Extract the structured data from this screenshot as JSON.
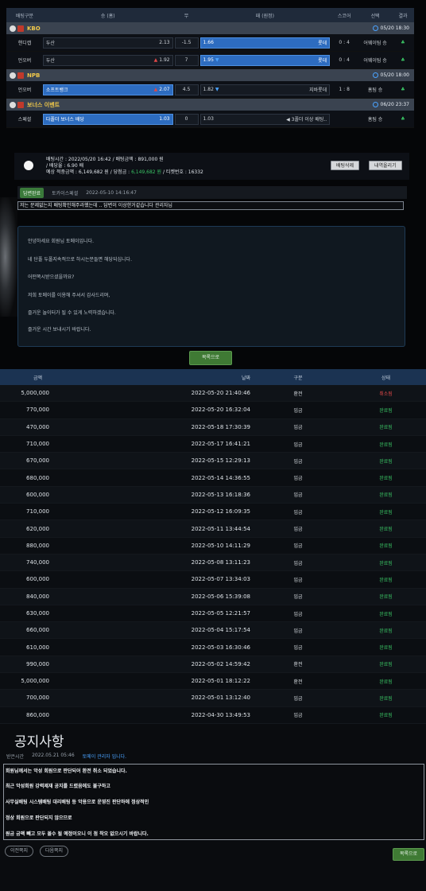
{
  "betslip": {
    "headers": [
      "배팅구분",
      "승 (홈)",
      "무",
      "패 (원정)",
      "스코어",
      "선택",
      "결과"
    ],
    "leagues": [
      {
        "name": "KBO",
        "date": "05/20 18:30",
        "rows": [
          {
            "type": "핸디캡",
            "home": "두산",
            "home_odds": "2.13",
            "home_arrow": "",
            "mid": "-1.5",
            "away": "롯데",
            "away_odds": "1.66",
            "away_arrow": "",
            "selected": "away",
            "score": "0 : 4",
            "pick": "어웨이팀 승",
            "result": "♣"
          },
          {
            "type": "언오버",
            "home": "두산",
            "home_odds": "1.92",
            "home_arrow": "▲",
            "mid": "7",
            "away": "롯데",
            "away_odds": "1.95",
            "away_arrow": "▼",
            "selected": "away",
            "score": "0 : 4",
            "pick": "어웨이팀 승",
            "result": "♣"
          }
        ]
      },
      {
        "name": "NPB",
        "date": "05/20 18:00",
        "rows": [
          {
            "type": "언오버",
            "home": "소프트뱅크",
            "home_odds": "2.07",
            "home_arrow": "▲",
            "mid": "4.5",
            "away": "지바롯데",
            "away_odds": "1.82",
            "away_arrow": "▼",
            "selected": "home",
            "score": "1 : 8",
            "pick": "홈팀 승",
            "result": "♣"
          }
        ]
      },
      {
        "name": "보너스 이벤트",
        "date": "06/20 23:37",
        "rows": [
          {
            "type": "스페셜",
            "home": "다폴더 보너스 배당",
            "home_odds": "1.03",
            "home_arrow": "",
            "mid": "0",
            "away": "◀ 3폴더 이상 배팅..",
            "away_odds": "1.03",
            "away_arrow": "",
            "selected": "home",
            "score": "",
            "pick": "홈팀 승",
            "result": "♣"
          }
        ]
      }
    ],
    "summary": {
      "line1": "배팅시간 : 2022/05/20 16:42  /  배팅금액 : 891,000 원",
      "line2": "/ 배당율 : 6.90 배",
      "line3_prefix": "예상 적중금액 : 6,149,682 원  /  당첨금 : ",
      "line3_win": "6,149,682 원",
      "line3_suffix": "  /  티켓번호 : 16332",
      "delete_label": "배팅삭제",
      "upload_label": "내역올리기"
    }
  },
  "inquiry": {
    "badge": "답변완료",
    "category": "토카이스페셜",
    "datetime": "2022-05-10 14:16:47",
    "title": "저는 문제없는지 배팅확인해주라했는데 .. 답변이 이상한거같습니다 관리자님",
    "lines": [
      "안녕하세요 회원님 토메이입니다.",
      "네 단폴 두폴지속적으로 하시는분들면 해당되십니다.",
      "어떤쪽시받으셨을까요?",
      "저희 토메이를 이용해 주셔서 감사드리며,",
      "즐거운 놀이터가 될 수 있게 노력하겠습니다.",
      "즐거운 시간 보내시기 바랍니다."
    ],
    "list_button": "목록으로"
  },
  "transactions": {
    "headers": [
      "금액",
      "날짜",
      "구분",
      "상태"
    ],
    "rows": [
      {
        "amount": "5,000,000",
        "date": "2022-05-20 21:40:46",
        "type": "환전",
        "status": "취소됨",
        "status_kind": "cancel"
      },
      {
        "amount": "770,000",
        "date": "2022-05-20 16:32:04",
        "type": "입금",
        "status": "완료됨",
        "status_kind": "ok"
      },
      {
        "amount": "470,000",
        "date": "2022-05-18 17:30:39",
        "type": "입금",
        "status": "완료됨",
        "status_kind": "ok"
      },
      {
        "amount": "710,000",
        "date": "2022-05-17 16:41:21",
        "type": "입금",
        "status": "완료됨",
        "status_kind": "ok"
      },
      {
        "amount": "670,000",
        "date": "2022-05-15 12:29:13",
        "type": "입금",
        "status": "완료됨",
        "status_kind": "ok"
      },
      {
        "amount": "680,000",
        "date": "2022-05-14 14:36:55",
        "type": "입금",
        "status": "완료됨",
        "status_kind": "ok"
      },
      {
        "amount": "600,000",
        "date": "2022-05-13 16:18:36",
        "type": "입금",
        "status": "완료됨",
        "status_kind": "ok"
      },
      {
        "amount": "710,000",
        "date": "2022-05-12 16:09:35",
        "type": "입금",
        "status": "완료됨",
        "status_kind": "ok"
      },
      {
        "amount": "620,000",
        "date": "2022-05-11 13:44:54",
        "type": "입금",
        "status": "완료됨",
        "status_kind": "ok"
      },
      {
        "amount": "880,000",
        "date": "2022-05-10 14:11:29",
        "type": "입금",
        "status": "완료됨",
        "status_kind": "ok"
      },
      {
        "amount": "740,000",
        "date": "2022-05-08 13:11:23",
        "type": "입금",
        "status": "완료됨",
        "status_kind": "ok"
      },
      {
        "amount": "600,000",
        "date": "2022-05-07 13:34:03",
        "type": "입금",
        "status": "완료됨",
        "status_kind": "ok"
      },
      {
        "amount": "840,000",
        "date": "2022-05-06 15:39:08",
        "type": "입금",
        "status": "완료됨",
        "status_kind": "ok"
      },
      {
        "amount": "630,000",
        "date": "2022-05-05 12:21:57",
        "type": "입금",
        "status": "완료됨",
        "status_kind": "ok"
      },
      {
        "amount": "660,000",
        "date": "2022-05-04 15:17:54",
        "type": "입금",
        "status": "완료됨",
        "status_kind": "ok"
      },
      {
        "amount": "610,000",
        "date": "2022-05-03 16:30:46",
        "type": "입금",
        "status": "완료됨",
        "status_kind": "ok"
      },
      {
        "amount": "990,000",
        "date": "2022-05-02 14:59:42",
        "type": "환전",
        "status": "완료됨",
        "status_kind": "ok"
      },
      {
        "amount": "5,000,000",
        "date": "2022-05-01 18:12:22",
        "type": "환전",
        "status": "완료됨",
        "status_kind": "ok"
      },
      {
        "amount": "700,000",
        "date": "2022-05-01 13:12:40",
        "type": "입금",
        "status": "완료됨",
        "status_kind": "ok"
      },
      {
        "amount": "860,000",
        "date": "2022-04-30 13:49:53",
        "type": "입금",
        "status": "완료됨",
        "status_kind": "ok"
      }
    ]
  },
  "notice": {
    "title": "공지사항",
    "meta_label": "받은시간",
    "meta_time": "2022.05.21 05:46",
    "meta_from": "토메이 관리자 입니다.",
    "lines": [
      "회원님께서는 악성 회원으로 판단되어 환전 취소 되었습니다.",
      "최근 악성회원 강력제재 공지를 드렸음에도 불구하고",
      "사무실배팅 시스템배팅 대리배팅 등 악용으로 운영진 판단하에 정상적인",
      "정상 회원으로 판단되지 않으므로",
      "원금 금액 빼고 모두 몰수 될 예정이오니 이 점 착오 없으시기 바랍니다."
    ],
    "prev_label": "이전쪽지",
    "next_label": "다음쪽지",
    "list_label": "목록으로"
  },
  "colors": {
    "selected_cell": "#2d6cc0",
    "ok_status": "#39c163",
    "cancel_status": "#e04848",
    "league_text": "#f0c84a",
    "green_button": "#3f7a34"
  }
}
